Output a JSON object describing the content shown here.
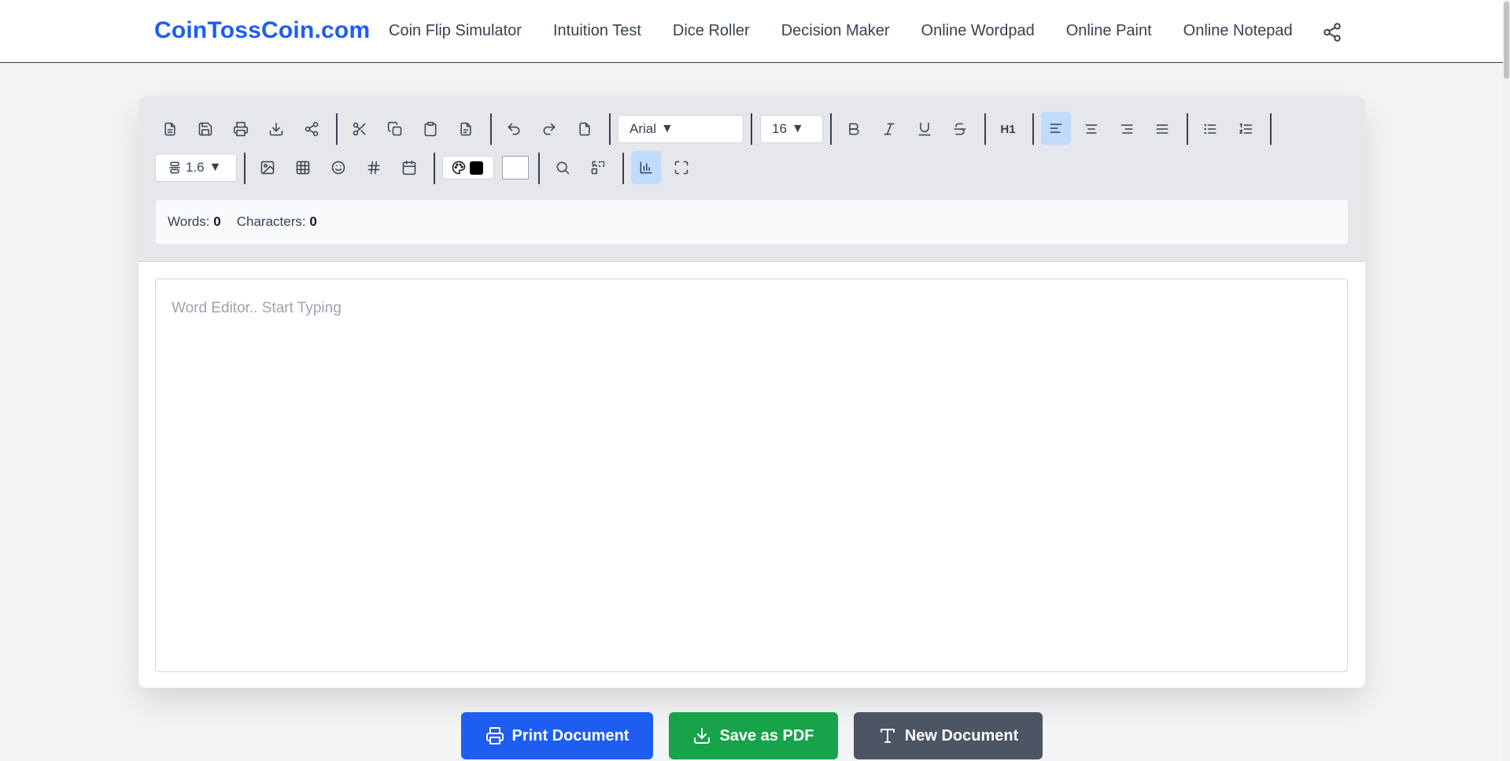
{
  "nav": {
    "brand": "CoinTossCoin.com",
    "links": [
      "Coin Flip Simulator",
      "Intuition Test",
      "Dice Roller",
      "Decision Maker",
      "Online Wordpad",
      "Online Paint",
      "Online Notepad"
    ]
  },
  "toolbar": {
    "font_family": "Arial",
    "font_size": "16",
    "line_height": "1.6",
    "dropdown_arrow": "▼",
    "heading_label": "H1",
    "text_color": "#000000",
    "highlight_color": "#ffffff"
  },
  "stats": {
    "words_label": "Words:",
    "words_value": "0",
    "chars_label": "Characters:",
    "chars_value": "0"
  },
  "editor": {
    "placeholder": "Word Editor.. Start Typing"
  },
  "actions": {
    "print_label": "Print Document",
    "pdf_label": "Save as PDF",
    "new_label": "New Document"
  },
  "colors": {
    "brand": "#1d5ef0",
    "print_button": "#1d5ef0",
    "pdf_button": "#16a34a",
    "new_button": "#4b5563",
    "active_tool": "#bfdbfe"
  }
}
